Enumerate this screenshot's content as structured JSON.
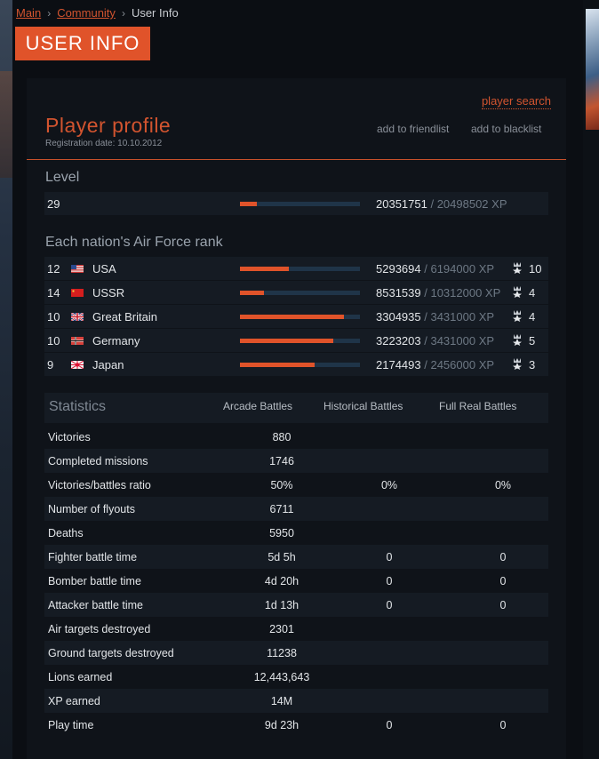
{
  "breadcrumb": {
    "main": "Main",
    "community": "Community",
    "current": "User Info"
  },
  "page_title": "USER INFO",
  "player_search": "player search",
  "profile": {
    "title": "Player profile",
    "registration": "Registration date: 10.10.2012",
    "add_friend": "add to friendlist",
    "add_blacklist": "add to blacklist"
  },
  "level": {
    "heading": "Level",
    "value": "29",
    "xp_current": "20351751",
    "xp_max": "/ 20498502 XP",
    "progress": 0.14
  },
  "ranks": {
    "heading": "Each nation's Air Force rank",
    "items": [
      {
        "level": "12",
        "nation": "USA",
        "xp_current": "5293694",
        "xp_max": "/ 6194000 XP",
        "rank": "10",
        "progress": 0.41,
        "flag": "usa-flag-icon"
      },
      {
        "level": "14",
        "nation": "USSR",
        "xp_current": "8531539",
        "xp_max": "/ 10312000 XP",
        "rank": "4",
        "progress": 0.2,
        "flag": "ussr-flag-icon"
      },
      {
        "level": "10",
        "nation": "Great Britain",
        "xp_current": "3304935",
        "xp_max": "/ 3431000 XP",
        "rank": "4",
        "progress": 0.87,
        "flag": "gb-flag-icon"
      },
      {
        "level": "10",
        "nation": "Germany",
        "xp_current": "3223203",
        "xp_max": "/ 3431000 XP",
        "rank": "5",
        "progress": 0.78,
        "flag": "germany-flag-icon"
      },
      {
        "level": "9",
        "nation": "Japan",
        "xp_current": "2174493",
        "xp_max": "/ 2456000 XP",
        "rank": "3",
        "progress": 0.62,
        "flag": "japan-flag-icon"
      }
    ]
  },
  "stats": {
    "heading": "Statistics",
    "columns": [
      "Arcade Battles",
      "Historical Battles",
      "Full Real Battles"
    ],
    "rows": [
      {
        "label": "Victories",
        "arcade": "880",
        "historical": "",
        "full_real": ""
      },
      {
        "label": "Completed missions",
        "arcade": "1746",
        "historical": "",
        "full_real": ""
      },
      {
        "label": "Victories/battles ratio",
        "arcade": "50%",
        "historical": "0%",
        "full_real": "0%"
      },
      {
        "label": "Number of flyouts",
        "arcade": "6711",
        "historical": "",
        "full_real": ""
      },
      {
        "label": "Deaths",
        "arcade": "5950",
        "historical": "",
        "full_real": ""
      },
      {
        "label": "Fighter battle time",
        "arcade": "5d 5h",
        "historical": "0",
        "full_real": "0"
      },
      {
        "label": "Bomber battle time",
        "arcade": "4d 20h",
        "historical": "0",
        "full_real": "0"
      },
      {
        "label": "Attacker battle time",
        "arcade": "1d 13h",
        "historical": "0",
        "full_real": "0"
      },
      {
        "label": "Air targets destroyed",
        "arcade": "2301",
        "historical": "",
        "full_real": ""
      },
      {
        "label": "Ground targets destroyed",
        "arcade": "11238",
        "historical": "",
        "full_real": ""
      },
      {
        "label": "Lions earned",
        "arcade": "12,443,643",
        "historical": "",
        "full_real": ""
      },
      {
        "label": "XP earned",
        "arcade": "14M",
        "historical": "",
        "full_real": ""
      },
      {
        "label": "Play time",
        "arcade": "9d 23h",
        "historical": "0",
        "full_real": "0"
      }
    ]
  },
  "colors": {
    "accent": "#e0532a",
    "bar_track": "#1f3448",
    "row_bg": "#151b23"
  }
}
